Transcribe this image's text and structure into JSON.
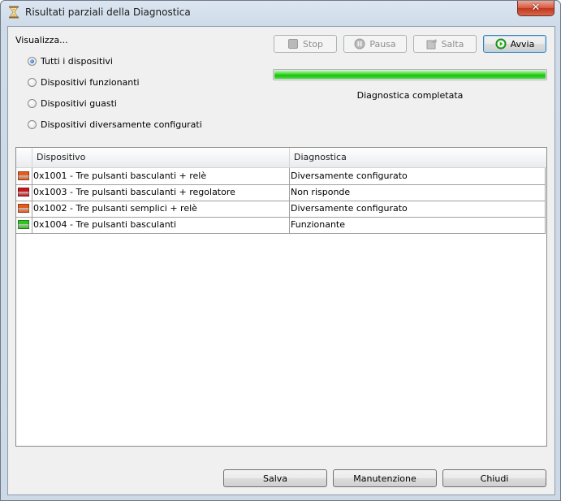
{
  "window": {
    "title": "Risultati parziali della Diagnostica",
    "close_label": "✕"
  },
  "filter": {
    "label": "Visualizza...",
    "options": [
      {
        "label": "Tutti i dispositivi",
        "checked": true
      },
      {
        "label": "Dispositivi funzionanti",
        "checked": false
      },
      {
        "label": "Dispositivi guasti",
        "checked": false
      },
      {
        "label": "Dispositivi diversamente configurati",
        "checked": false
      }
    ]
  },
  "controls": {
    "stop_label": "Stop",
    "pausa_label": "Pausa",
    "salta_label": "Salta",
    "avvia_label": "Avvia"
  },
  "progress": {
    "value_percent": 100,
    "status_text": "Diagnostica completata",
    "color": "#22c414"
  },
  "table": {
    "columns": [
      "Dispositivo",
      "Diagnostica"
    ],
    "rows": [
      {
        "icon": "orange-status-icon",
        "color": "#e8591a",
        "device": "0x1001 - Tre pulsanti basculanti + relè",
        "diagnostic": "Diversamente configurato"
      },
      {
        "icon": "red-status-icon",
        "color": "#c8161b",
        "device": "0x1003 - Tre pulsanti basculanti + regolatore",
        "diagnostic": "Non risponde"
      },
      {
        "icon": "orange-status-icon",
        "color": "#e8591a",
        "device": "0x1002 - Tre pulsanti semplici + relè",
        "diagnostic": "Diversamente configurato"
      },
      {
        "icon": "green-status-icon",
        "color": "#2fc51f",
        "device": "0x1004 - Tre pulsanti basculanti",
        "diagnostic": "Funzionante"
      }
    ]
  },
  "footer": {
    "salva_label": "Salva",
    "manutenzione_label": "Manutenzione",
    "chiudi_label": "Chiudi"
  }
}
